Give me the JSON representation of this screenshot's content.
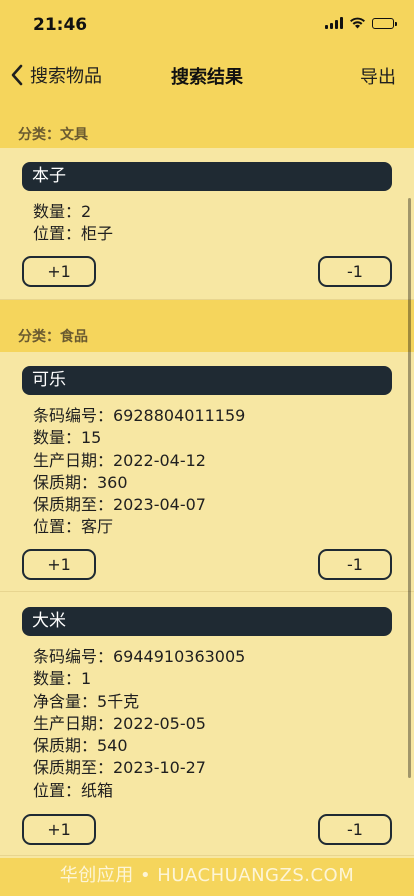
{
  "status_bar": {
    "time": "21:46"
  },
  "nav": {
    "back_label": "搜索物品",
    "title": "搜索结果",
    "action_label": "导出"
  },
  "sections": [
    {
      "header": "分类：文具",
      "items": [
        {
          "name": "本子",
          "fields": [
            "数量：2",
            "位置：柜子"
          ],
          "increment_label": "+1",
          "decrement_label": "-1"
        }
      ]
    },
    {
      "header": "分类：食品",
      "items": [
        {
          "name": "可乐",
          "fields": [
            "条码编号：6928804011159",
            "数量：15",
            "生产日期：2022-04-12",
            "保质期：360",
            "保质期至：2023-04-07",
            "位置：客厅"
          ],
          "increment_label": "+1",
          "decrement_label": "-1"
        },
        {
          "name": "大米",
          "fields": [
            "条码编号：6944910363005",
            "数量：1",
            "净含量：5千克",
            "生产日期：2022-05-05",
            "保质期：540",
            "保质期至：2023-10-27",
            "位置：纸箱"
          ],
          "increment_label": "+1",
          "decrement_label": "-1"
        }
      ]
    }
  ],
  "watermark": "华创应用 • HUACHUANGZS.COM",
  "colors": {
    "accent": "#f5d55c",
    "background": "#f7e7a3",
    "title_bar": "#1f2a33"
  }
}
